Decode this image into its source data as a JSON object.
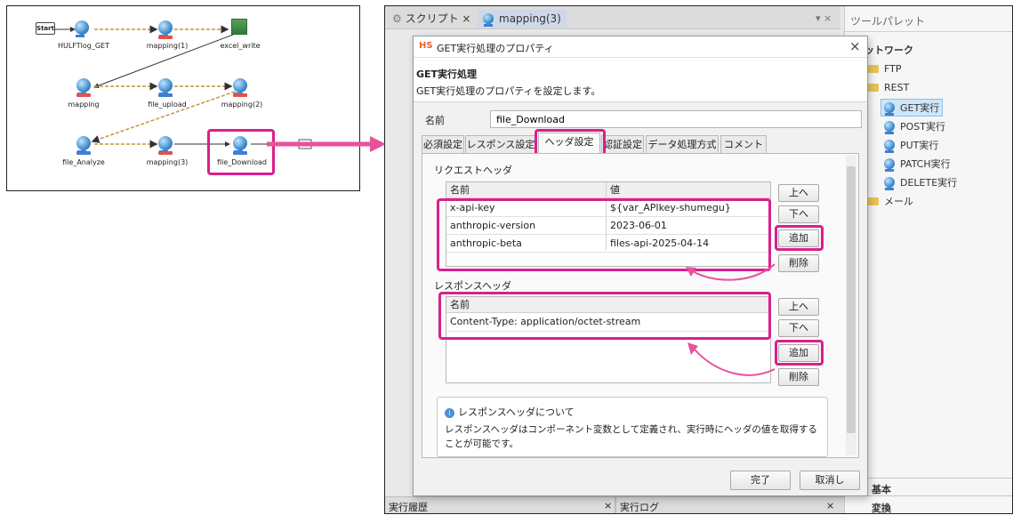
{
  "flow": {
    "start_label": "Start",
    "nodes": [
      {
        "label": "HULFTlog_GET"
      },
      {
        "label": "mapping(1)"
      },
      {
        "label": "excel_write"
      },
      {
        "label": "mapping"
      },
      {
        "label": "file_upload"
      },
      {
        "label": "mapping(2)"
      },
      {
        "label": "file_Analyze"
      },
      {
        "label": "mapping(3)"
      },
      {
        "label": "file_Download"
      }
    ]
  },
  "ide": {
    "tabs": [
      {
        "label": "スクリプト",
        "close": "×"
      },
      {
        "label": "mapping(3)"
      }
    ],
    "tab_controls": "▾ ×",
    "bottom_tabs": [
      {
        "label": "実行履歴",
        "close": "×"
      },
      {
        "label": "実行ログ",
        "close": "×"
      }
    ]
  },
  "palette": {
    "title": "ツールパレット",
    "section": "ットワーク",
    "items": [
      {
        "label": "FTP"
      },
      {
        "label": "REST"
      },
      {
        "label": "GET実行"
      },
      {
        "label": "POST実行"
      },
      {
        "label": "PUT実行"
      },
      {
        "label": "PATCH実行"
      },
      {
        "label": "DELETE実行"
      },
      {
        "label": "メール"
      }
    ],
    "bottom": [
      "基本",
      "変換"
    ]
  },
  "dialog": {
    "logo": "HS",
    "title": "GET実行処理のプロパティ",
    "close": "×",
    "heading": "GET実行処理",
    "description": "GET実行処理のプロパティを設定します。",
    "name_label": "名前",
    "name_value": "file_Download",
    "tabs": [
      "必須設定",
      "レスポンス設定",
      "ヘッダ設定",
      "認証設定",
      "データ処理方式",
      "コメント"
    ],
    "request": {
      "label": "リクエストヘッダ",
      "col_name": "名前",
      "col_value": "値",
      "rows": [
        {
          "name": "x-api-key",
          "value": "${var_APIkey-shumegu}"
        },
        {
          "name": "anthropic-version",
          "value": "2023-06-01"
        },
        {
          "name": "anthropic-beta",
          "value": "files-api-2025-04-14"
        }
      ]
    },
    "response": {
      "label": "レスポンスヘッダ",
      "col_name": "名前",
      "rows": [
        {
          "name": "Content-Type: application/octet-stream"
        }
      ]
    },
    "buttons": {
      "up": "上へ",
      "down": "下へ",
      "add": "追加",
      "delete": "削除"
    },
    "info": {
      "title": "レスポンスヘッダについて",
      "body": "レスポンスヘッダはコンポーネント変数として定義され、実行時にヘッダの値を取得することが可能です。"
    },
    "ok": "完了",
    "cancel": "取消し"
  },
  "colors": {
    "highlight": "#d9208c",
    "arrow": "#e8529a"
  }
}
